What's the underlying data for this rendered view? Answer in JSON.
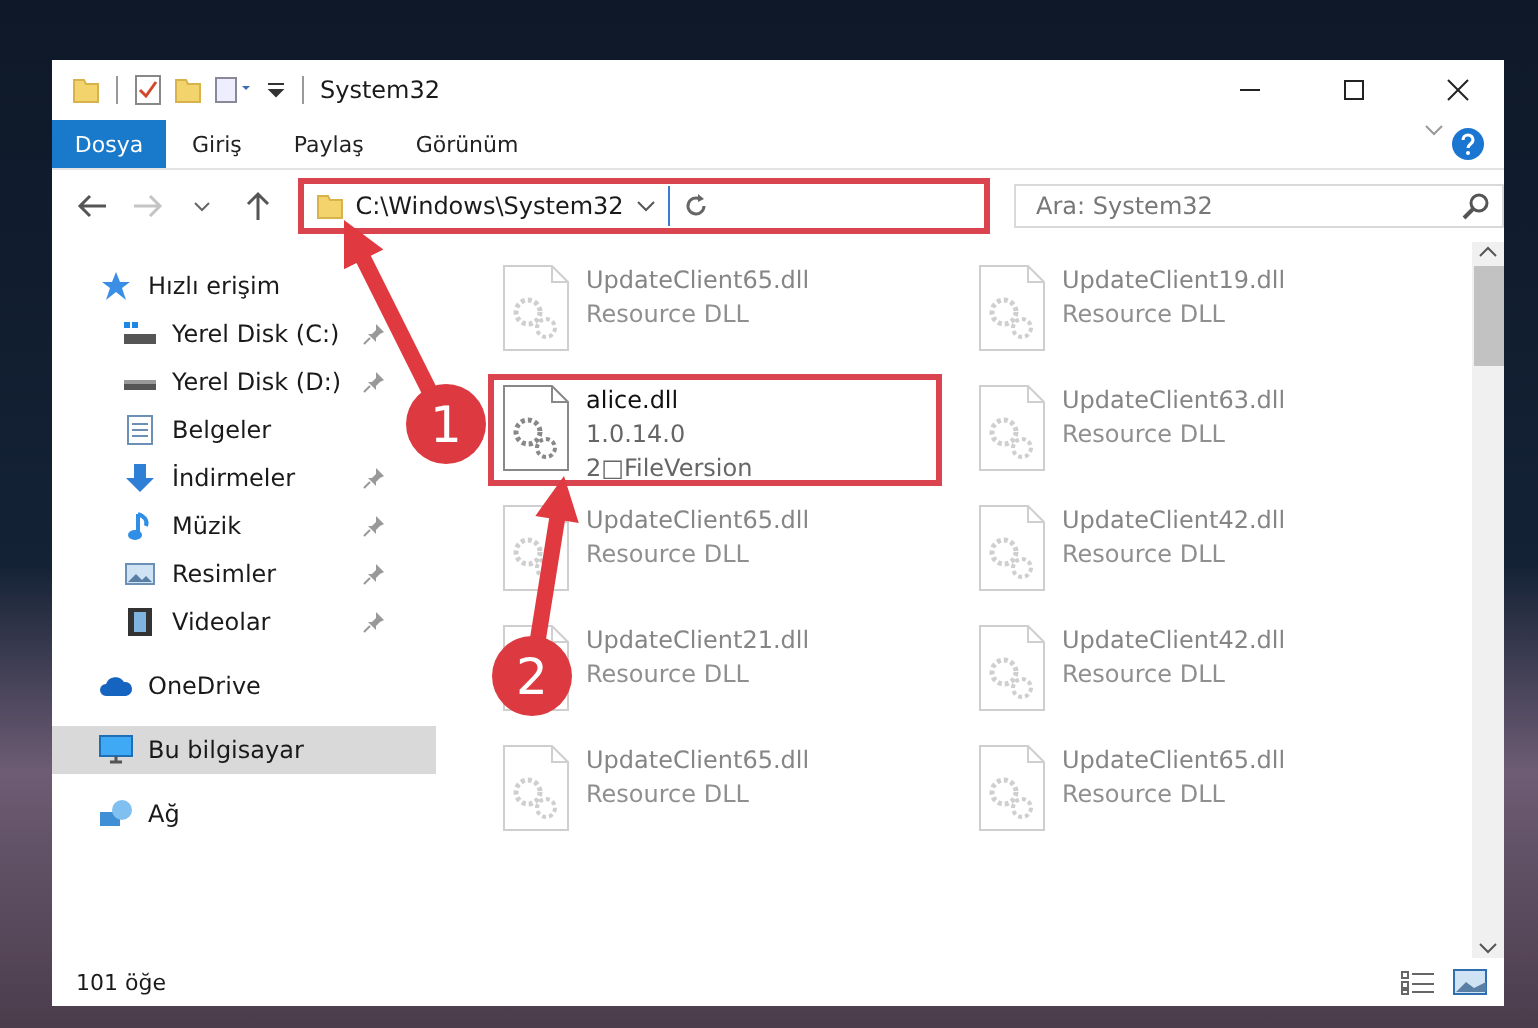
{
  "window": {
    "title": "System32"
  },
  "ribbon_tabs": [
    {
      "label": "Dosya",
      "kind": "file"
    },
    {
      "label": "Giriş",
      "kind": "tab"
    },
    {
      "label": "Paylaş",
      "kind": "tab"
    },
    {
      "label": "Görünüm",
      "kind": "tab"
    }
  ],
  "navigation": {
    "back_disabled": false,
    "forward_disabled": true
  },
  "address_bar": {
    "path": "C:\\Windows\\System32",
    "highlighted": true
  },
  "search": {
    "placeholder": "Ara: System32"
  },
  "sidebar": {
    "items": [
      {
        "label": "Hızlı erişim",
        "kind": "star",
        "selected": false,
        "children": [
          {
            "label": "Yerel Disk (C:)",
            "kind": "drive-win",
            "pinned": true,
            "selected": false
          },
          {
            "label": "Yerel Disk (D:)",
            "kind": "drive",
            "pinned": true,
            "selected": false
          },
          {
            "label": "Belgeler",
            "kind": "docs",
            "pinned": false,
            "selected": false
          },
          {
            "label": "İndirmeler",
            "kind": "download",
            "pinned": true,
            "selected": false
          },
          {
            "label": "Müzik",
            "kind": "music",
            "pinned": true,
            "selected": false
          },
          {
            "label": "Resimler",
            "kind": "pictures",
            "pinned": true,
            "selected": false
          },
          {
            "label": "Videolar",
            "kind": "videos",
            "pinned": true,
            "selected": false
          }
        ]
      },
      {
        "label": "OneDrive",
        "kind": "cloud",
        "selected": false
      },
      {
        "label": "Bu bilgisayar",
        "kind": "pc",
        "selected": true
      },
      {
        "label": "Ağ",
        "kind": "network",
        "selected": false
      }
    ]
  },
  "files": [
    {
      "name": "UpdateClient65.dll",
      "details": [
        "Resource DLL"
      ],
      "faded": true,
      "highlighted": false
    },
    {
      "name": "UpdateClient19.dll",
      "details": [
        "Resource DLL"
      ],
      "faded": true,
      "highlighted": false
    },
    {
      "name": "alice.dll",
      "details": [
        "1.0.14.0",
        "2□FileVersion"
      ],
      "faded": false,
      "highlighted": true
    },
    {
      "name": "UpdateClient63.dll",
      "details": [
        "Resource DLL"
      ],
      "faded": true,
      "highlighted": false
    },
    {
      "name": "UpdateClient65.dll",
      "details": [
        "Resource DLL"
      ],
      "faded": true,
      "highlighted": false
    },
    {
      "name": "UpdateClient42.dll",
      "details": [
        "Resource DLL"
      ],
      "faded": true,
      "highlighted": false
    },
    {
      "name": "UpdateClient21.dll",
      "details": [
        "Resource DLL"
      ],
      "faded": true,
      "highlighted": false
    },
    {
      "name": "UpdateClient42.dll",
      "details": [
        "Resource DLL"
      ],
      "faded": true,
      "highlighted": false
    },
    {
      "name": "UpdateClient65.dll",
      "details": [
        "Resource DLL"
      ],
      "faded": true,
      "highlighted": false
    },
    {
      "name": "UpdateClient65.dll",
      "details": [
        "Resource DLL"
      ],
      "faded": true,
      "highlighted": false
    }
  ],
  "status_bar": {
    "item_count": "101 öğe"
  },
  "annotations": [
    {
      "label": "1"
    },
    {
      "label": "2"
    }
  ]
}
